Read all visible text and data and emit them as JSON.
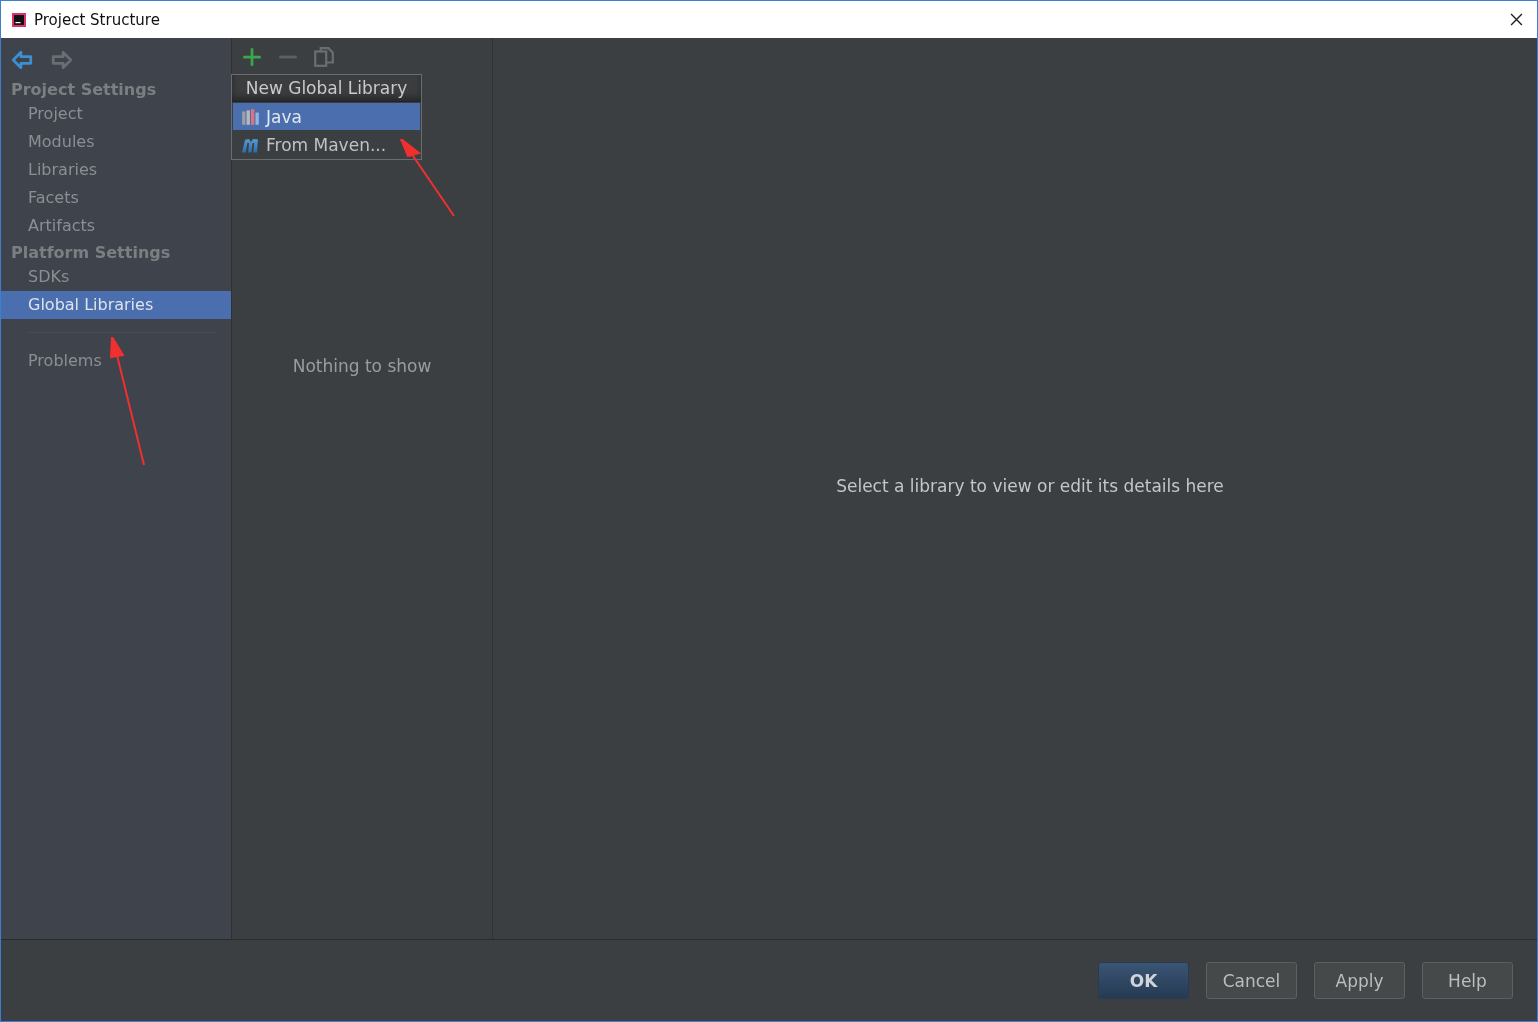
{
  "window": {
    "title": "Project Structure"
  },
  "sidebar": {
    "items": [
      {
        "kind": "header",
        "label": "Project Settings"
      },
      {
        "kind": "item",
        "label": "Project",
        "selected": false
      },
      {
        "kind": "item",
        "label": "Modules",
        "selected": false
      },
      {
        "kind": "item",
        "label": "Libraries",
        "selected": false
      },
      {
        "kind": "item",
        "label": "Facets",
        "selected": false
      },
      {
        "kind": "item",
        "label": "Artifacts",
        "selected": false
      },
      {
        "kind": "header",
        "label": "Platform Settings"
      },
      {
        "kind": "item",
        "label": "SDKs",
        "selected": false
      },
      {
        "kind": "item",
        "label": "Global Libraries",
        "selected": true
      },
      {
        "kind": "separator"
      },
      {
        "kind": "item",
        "label": "Problems",
        "selected": false
      }
    ]
  },
  "library_list": {
    "empty_text": "Nothing to show"
  },
  "popup": {
    "title": "New Global Library",
    "items": [
      {
        "kind": "java",
        "label": "Java",
        "selected": true
      },
      {
        "kind": "maven",
        "label": "From Maven...",
        "selected": false
      }
    ]
  },
  "details": {
    "empty_text": "Select a library to view or edit its details here"
  },
  "buttons": [
    {
      "label": "OK",
      "default": true
    },
    {
      "label": "Cancel",
      "default": false
    },
    {
      "label": "Apply",
      "default": false
    },
    {
      "label": "Help",
      "default": false
    }
  ]
}
